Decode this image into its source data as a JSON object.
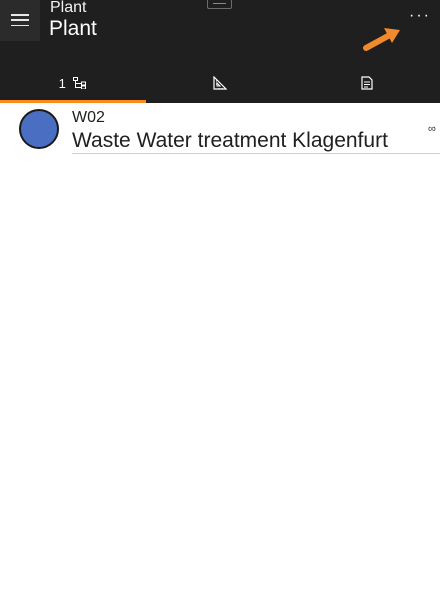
{
  "header": {
    "subtitle": "Plant",
    "title": "Plant",
    "menu_icon": "hamburger-menu-icon",
    "more_label": "···",
    "arrow_color": "#f08a2c"
  },
  "tabs": [
    {
      "count": "1",
      "icon": "hierarchy-icon",
      "active": true
    },
    {
      "icon": "ruler-triangle-icon",
      "active": false
    },
    {
      "icon": "document-list-icon",
      "active": false
    }
  ],
  "list": {
    "items": [
      {
        "code": "W02",
        "name": "Waste Water treatment Klagenfurt",
        "trailing_icon": "∞",
        "avatar_color": "#4a6ec2"
      }
    ]
  },
  "colors": {
    "header_bg": "#1f1f1f",
    "tab_accent": "#ff8a1c"
  }
}
